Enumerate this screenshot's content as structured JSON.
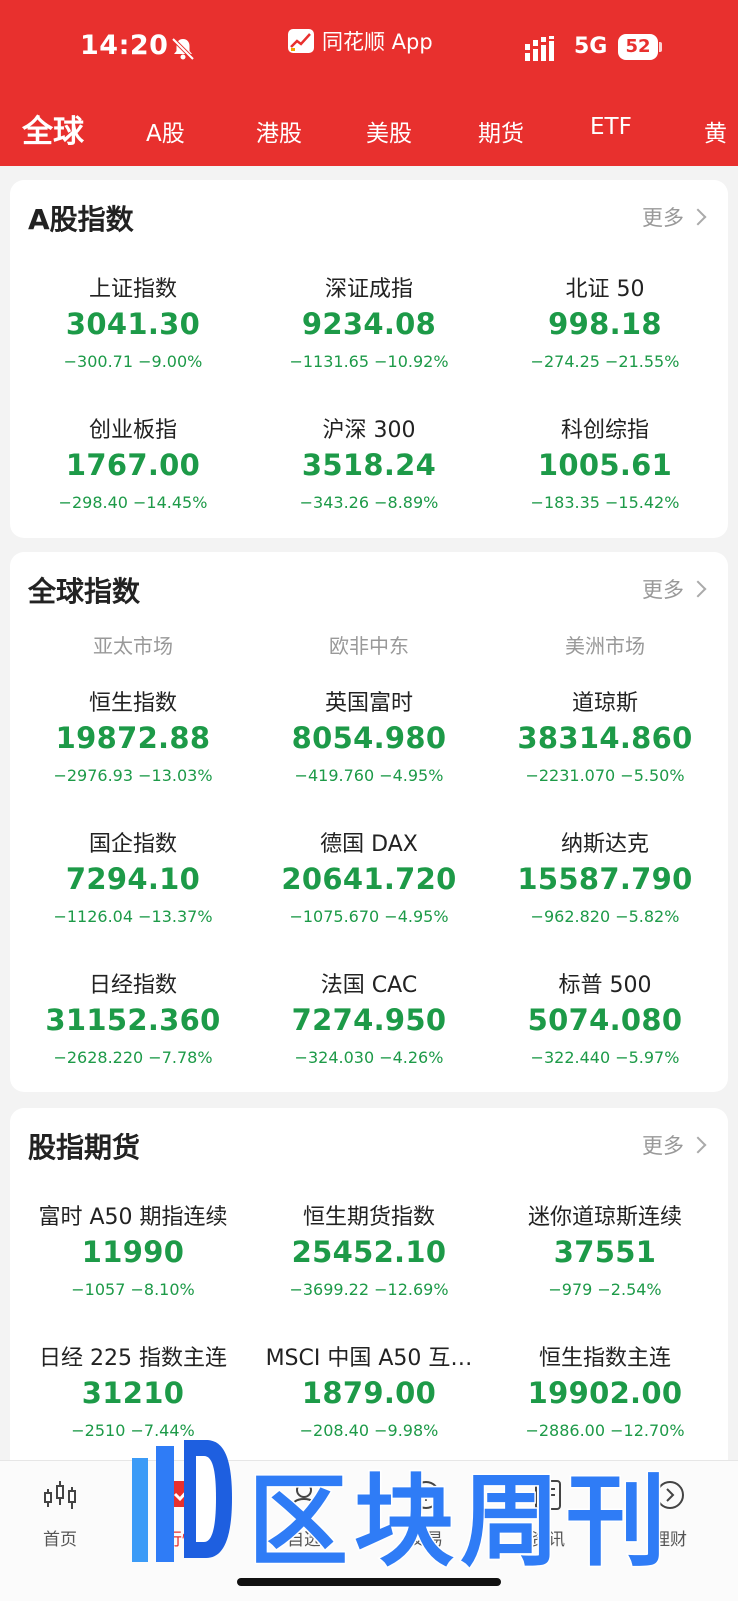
{
  "status_bar": {
    "time": "14:20",
    "app_name": "同花顺 App",
    "network": "5G",
    "battery": "52"
  },
  "tabs": [
    "全球",
    "A股",
    "港股",
    "美股",
    "期货",
    "ETF",
    "黄"
  ],
  "cards": [
    {
      "title": "A股指数",
      "more": "更多",
      "rows": [
        [
          {
            "name": "上证指数",
            "price": "3041.30",
            "change": "−300.71  −9.00%"
          },
          {
            "name": "深证成指",
            "price": "9234.08",
            "change": "−1131.65  −10.92%"
          },
          {
            "name": "北证 50",
            "price": "998.18",
            "change": "−274.25  −21.55%"
          }
        ],
        [
          {
            "name": "创业板指",
            "price": "1767.00",
            "change": "−298.40  −14.45%"
          },
          {
            "name": "沪深 300",
            "price": "3518.24",
            "change": "−343.26  −8.89%"
          },
          {
            "name": "科创综指",
            "price": "1005.61",
            "change": "−183.35  −15.42%"
          }
        ]
      ]
    },
    {
      "title": "全球指数",
      "more": "更多",
      "regions": [
        "亚太市场",
        "欧非中东",
        "美洲市场"
      ],
      "rows": [
        [
          {
            "name": "恒生指数",
            "price": "19872.88",
            "change": "−2976.93  −13.03%"
          },
          {
            "name": "英国富时",
            "price": "8054.980",
            "change": "−419.760  −4.95%"
          },
          {
            "name": "道琼斯",
            "price": "38314.860",
            "change": "−2231.070  −5.50%"
          }
        ],
        [
          {
            "name": "国企指数",
            "price": "7294.10",
            "change": "−1126.04  −13.37%"
          },
          {
            "name": "德国 DAX",
            "price": "20641.720",
            "change": "−1075.670  −4.95%"
          },
          {
            "name": "纳斯达克",
            "price": "15587.790",
            "change": "−962.820  −5.82%"
          }
        ],
        [
          {
            "name": "日经指数",
            "price": "31152.360",
            "change": "−2628.220  −7.78%"
          },
          {
            "name": "法国 CAC",
            "price": "7274.950",
            "change": "−324.030  −4.26%"
          },
          {
            "name": "标普 500",
            "price": "5074.080",
            "change": "−322.440  −5.97%"
          }
        ]
      ]
    },
    {
      "title": "股指期货",
      "more": "更多",
      "rows": [
        [
          {
            "name": "富时 A50 期指连续",
            "price": "11990",
            "change": "−1057  −8.10%"
          },
          {
            "name": "恒生期货指数",
            "price": "25452.10",
            "change": "−3699.22  −12.69%"
          },
          {
            "name": "迷你道琼斯连续",
            "price": "37551",
            "change": "−979  −2.54%"
          }
        ],
        [
          {
            "name": "日经 225 指数主连",
            "price": "31210",
            "change": "−2510  −7.44%"
          },
          {
            "name": "MSCI 中国 A50 互…",
            "price": "1879.00",
            "change": "−208.40  −9.98%"
          },
          {
            "name": "恒生指数主连",
            "price": "19902.00",
            "change": "−2886.00  −12.70%"
          }
        ]
      ]
    }
  ],
  "bottom_nav": [
    {
      "label": "首页",
      "icon": "candlestick-icon"
    },
    {
      "label": "行情",
      "icon": "market-icon"
    },
    {
      "label": "自选",
      "icon": "watchlist-icon"
    },
    {
      "label": "交易",
      "icon": "trade-icon"
    },
    {
      "label": "资讯",
      "icon": "news-icon"
    },
    {
      "label": "理财",
      "icon": "wealth-icon"
    }
  ],
  "watermark": {
    "text": "区块周刊",
    "color": "#2f7cf6"
  },
  "colors": {
    "header": "#e8302e",
    "down": "#1d9a48"
  }
}
